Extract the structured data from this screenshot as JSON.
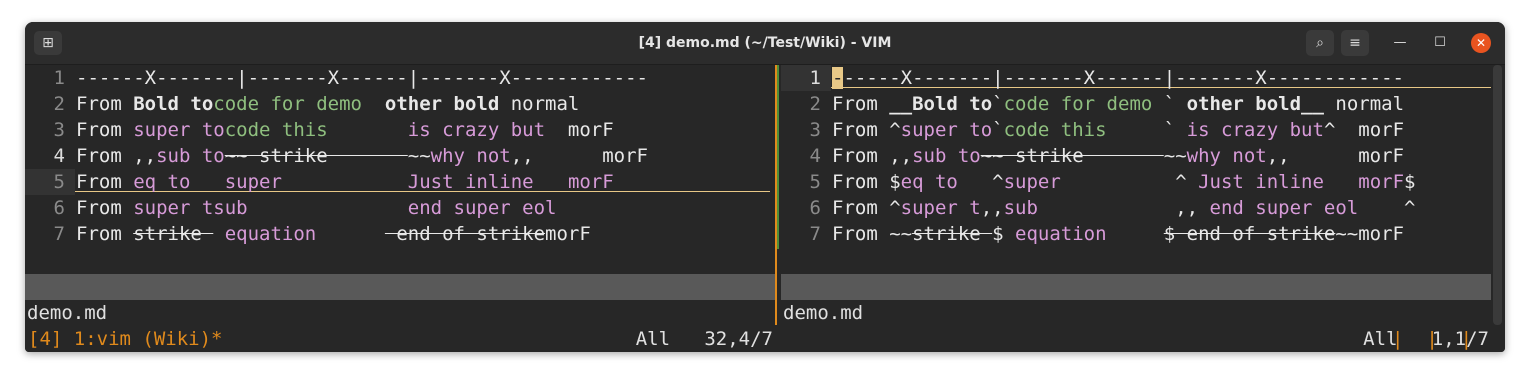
{
  "window": {
    "title": "[4] demo.md (~/Test/Wiki) - VIM",
    "new_tab_icon": "⊞",
    "search_icon": "⌕",
    "menu_icon": "≡",
    "minimize_icon": "—",
    "maximize_icon": "☐",
    "close_icon": "✕"
  },
  "left_pane": {
    "line_numbers": [
      "1",
      "2",
      "3",
      "4",
      "5",
      "6",
      "7"
    ],
    "lines": [
      [
        {
          "t": "------X-------|-------X------|-------X------------"
        }
      ],
      [
        {
          "t": "From "
        },
        {
          "t": "Bold to",
          "c": "b"
        },
        {
          "t": "code for demo  ",
          "c": "g"
        },
        {
          "t": "other bold",
          "c": "b"
        },
        {
          "t": " normal"
        }
      ],
      [
        {
          "t": "From "
        },
        {
          "t": "super to",
          "c": "p"
        },
        {
          "t": "code this      ",
          "c": "g"
        },
        {
          "t": " is crazy but",
          "c": "p"
        },
        {
          "t": "  morF"
        }
      ],
      [
        {
          "t": "From ,,"
        },
        {
          "t": "sub to",
          "c": "p"
        },
        {
          "t": "~~ strike       ",
          "c": "s"
        },
        {
          "t": "~~"
        },
        {
          "t": "why not",
          "c": "p"
        },
        {
          "t": ",,      morF"
        }
      ],
      [
        {
          "t": "From "
        },
        {
          "t": "eq to",
          "c": "p"
        },
        {
          "t": "   "
        },
        {
          "t": "super",
          "c": "p"
        },
        {
          "t": "           "
        },
        {
          "t": "Just inline",
          "c": "p"
        },
        {
          "t": "   "
        },
        {
          "t": "morF",
          "c": "p"
        }
      ],
      [
        {
          "t": "From "
        },
        {
          "t": "super tsub",
          "c": "p"
        },
        {
          "t": "              "
        },
        {
          "t": "end super eol",
          "c": "p"
        }
      ],
      [
        {
          "t": "From "
        },
        {
          "t": "strike ",
          "c": "s"
        },
        {
          "t": " "
        },
        {
          "t": "equation",
          "c": "p"
        },
        {
          "t": "      "
        },
        {
          "t": " end of strike",
          "c": "s"
        },
        {
          "t": "morF"
        }
      ]
    ],
    "status_file": "demo.md",
    "status_pos": "All   32,4/7"
  },
  "right_pane": {
    "line_numbers": [
      "1",
      "2",
      "3",
      "4",
      "5",
      "6",
      "7"
    ],
    "lines": [
      [
        {
          "t": "-",
          "c": "cursor"
        },
        {
          "t": "-----X-------|-------X------|-------X------------"
        }
      ],
      [
        {
          "t": "From "
        },
        {
          "t": "__Bold to",
          "c": "b"
        },
        {
          "t": "`"
        },
        {
          "t": "code for demo ",
          "c": "g"
        },
        {
          "t": "` "
        },
        {
          "t": "other bold__",
          "c": "b"
        },
        {
          "t": " normal"
        }
      ],
      [
        {
          "t": "From ^"
        },
        {
          "t": "super to",
          "c": "p"
        },
        {
          "t": "`"
        },
        {
          "t": "code this     ",
          "c": "g"
        },
        {
          "t": "` "
        },
        {
          "t": "is crazy but",
          "c": "p"
        },
        {
          "t": "^  morF"
        }
      ],
      [
        {
          "t": "From ,,"
        },
        {
          "t": "sub to",
          "c": "p"
        },
        {
          "t": "~~ strike       ",
          "c": "s"
        },
        {
          "t": "~~"
        },
        {
          "t": "why not",
          "c": "p"
        },
        {
          "t": ",,      morF"
        }
      ],
      [
        {
          "t": "From $"
        },
        {
          "t": "eq to",
          "c": "p"
        },
        {
          "t": "   ^"
        },
        {
          "t": "super",
          "c": "p"
        },
        {
          "t": "          ^ "
        },
        {
          "t": "Just inline",
          "c": "p"
        },
        {
          "t": "   "
        },
        {
          "t": "morF",
          "c": "p"
        },
        {
          "t": "$"
        }
      ],
      [
        {
          "t": "From ^"
        },
        {
          "t": "super t",
          "c": "p"
        },
        {
          "t": ",,"
        },
        {
          "t": "sub",
          "c": "p"
        },
        {
          "t": "            ,, "
        },
        {
          "t": "end super eol",
          "c": "p"
        },
        {
          "t": "    ^"
        }
      ],
      [
        {
          "t": "From ~~"
        },
        {
          "t": "strike ",
          "c": "s"
        },
        {
          "t": "$ "
        },
        {
          "t": "equation",
          "c": "p"
        },
        {
          "t": "     "
        },
        {
          "t": "$ end of strike",
          "c": "s"
        },
        {
          "t": "~~morF"
        }
      ]
    ],
    "status_file": "demo.md",
    "status_pos": "All   1,1/7"
  },
  "tmux": {
    "left": "[4] 1:vim (Wiki)*",
    "right": "|  |  |"
  },
  "colors": {
    "accent_orange": "#e08a1c",
    "close_red": "#e95420",
    "code_green": "#8fbf7f",
    "markup_pink": "#d79bd8"
  }
}
